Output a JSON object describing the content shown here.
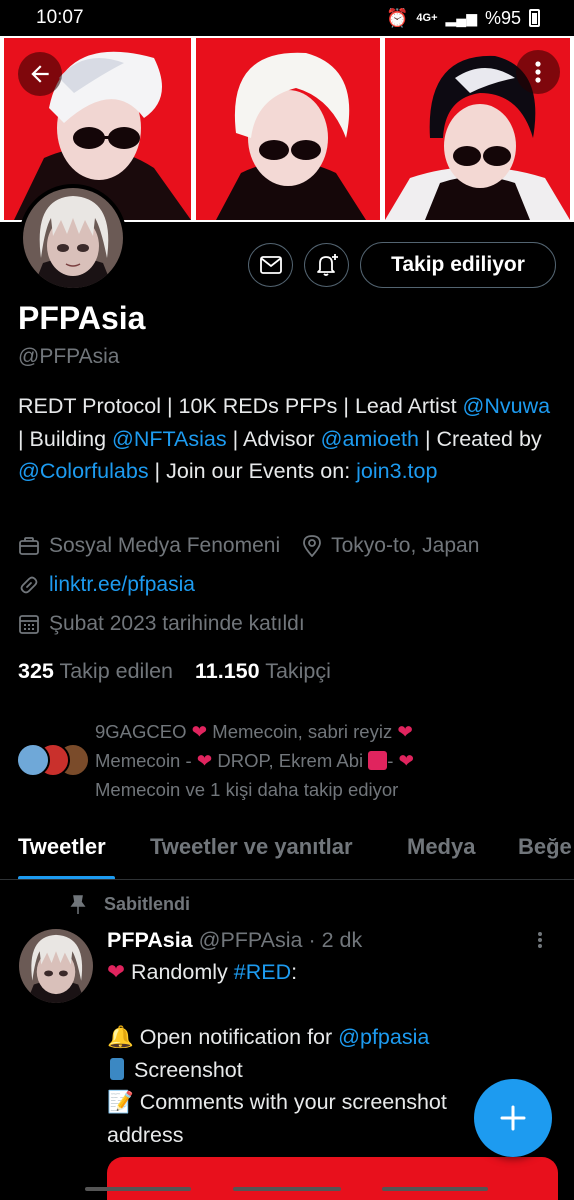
{
  "status_bar": {
    "time": "10:07",
    "network": "4G+",
    "battery": "%95"
  },
  "profile": {
    "name": "PFPAsia",
    "handle": "@PFPAsia",
    "follow_button": "Takip ediliyor",
    "bio": {
      "t1": "REDT Protocol | 10K REDs PFPs | Lead Artist ",
      "m1": "@Nvuwa",
      "t2": " | Building ",
      "m2": "@NFTAsias",
      "t3": " | Advisor ",
      "m3": "@amioeth",
      "t4": " | Created by ",
      "m4": "@Colorfulabs",
      "t5": " | Join our Events on: ",
      "link": "join3.top"
    },
    "category": "Sosyal Medya Fenomeni",
    "location": "Tokyo-to, Japan",
    "website": "linktr.ee/pfpasia",
    "joined": "Şubat 2023 tarihinde katıldı",
    "following_count": "325",
    "following_label": "Takip edilen",
    "followers_count": "11.150",
    "followers_label": "Takipçi"
  },
  "followed_by": {
    "p1": "9GAGCEO ",
    "p2": " Memecoin, sabri reyiz ",
    "p3": " Memecoin - ",
    "p4": " DROP, Ekrem Abi ",
    "p5": "- ",
    "p6": " Memecoin ve 1 kişi daha takip ediyor"
  },
  "tabs": [
    "Tweetler",
    "Tweetler ve yanıtlar",
    "Medya",
    "Beğe"
  ],
  "tweet": {
    "pinned_label": "Sabitlendi",
    "author_name": "PFPAsia",
    "author_handle": "@PFPAsia",
    "time": "· 2 dk",
    "l1_pre": " Randomly ",
    "l1_tag": "#RED",
    "l1_post": ":",
    "l2_pre": " Open notification for ",
    "l2_mention": "@pfpasia",
    "l3": " Screenshot",
    "l4": " Comments with your screenshot",
    "l5": "address"
  },
  "colors": {
    "accent": "#1d9bf0",
    "banner_red": "#e8101c",
    "heart": "#e0245e"
  }
}
